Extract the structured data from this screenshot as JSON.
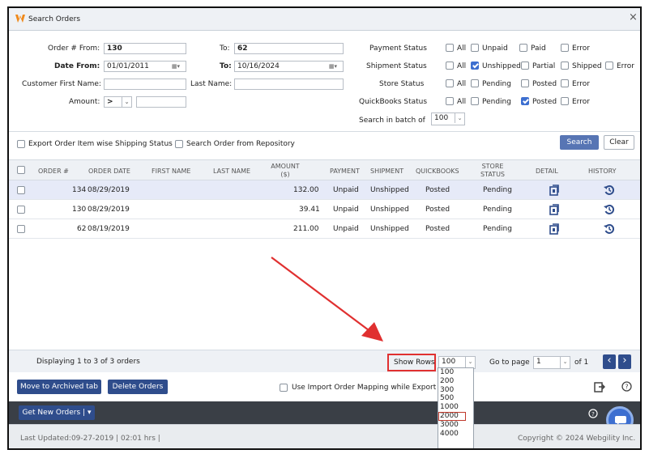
{
  "window": {
    "title": "Search Orders",
    "close": "×"
  },
  "filters": {
    "order_from_label": "Order # From:",
    "order_from": "130",
    "order_to_label": "To:",
    "order_to": "62",
    "date_from_label": "Date From:",
    "date_from": "01/01/2011",
    "date_to_label": "To:",
    "date_to": "10/16/2024",
    "first_name_label": "Customer First Name:",
    "first_name": "",
    "last_name_label": "Last Name:",
    "last_name": "",
    "amount_label": "Amount:",
    "amount_op": ">",
    "amount": "",
    "payment_label": "Payment Status",
    "shipment_label": "Shipment Status",
    "store_label": "Store  Status",
    "quickbooks_label": "QuickBooks Status",
    "batch_label": "Search in batch of",
    "batch": "100",
    "opt_all": "All",
    "opt_unpaid": "Unpaid",
    "opt_paid": "Paid",
    "opt_error": "Error",
    "opt_unshipped": "Unshipped",
    "opt_partial": "Partial",
    "opt_shipped": "Shipped",
    "opt_pending": "Pending",
    "opt_posted": "Posted"
  },
  "options": {
    "export_label": "Export Order Item wise Shipping Status",
    "repo_label": "Search Order from Repository",
    "search": "Search",
    "clear": "Clear"
  },
  "table": {
    "headers": {
      "order": "ORDER #",
      "date": "ORDER DATE",
      "first": "FIRST NAME",
      "last": "LAST NAME",
      "amount1": "AMOUNT",
      "amount2": "($)",
      "payment": "PAYMENT",
      "shipment": "SHIPMENT",
      "quickbooks": "QUICKBOOKS",
      "store1": "STORE",
      "store2": "STATUS",
      "detail": "DETAIL",
      "history": "HISTORY"
    },
    "rows": [
      {
        "order": "134",
        "date": "08/29/2019",
        "amount": "132.00",
        "payment": "Unpaid",
        "shipment": "Unshipped",
        "quickbooks": "Posted",
        "store": "Pending"
      },
      {
        "order": "130",
        "date": "08/29/2019",
        "amount": "39.41",
        "payment": "Unpaid",
        "shipment": "Unshipped",
        "quickbooks": "Posted",
        "store": "Pending"
      },
      {
        "order": "62",
        "date": "08/19/2019",
        "amount": "211.00",
        "payment": "Unpaid",
        "shipment": "Unshipped",
        "quickbooks": "Posted",
        "store": "Pending"
      }
    ]
  },
  "footer": {
    "displaying": "Displaying 1 to 3 of 3 orders",
    "show_rows": "Show Rows",
    "rows_value": "100",
    "goto_label": "Go to page",
    "page": "1",
    "of": "of 1",
    "rows_options": [
      "100",
      "200",
      "300",
      "500",
      "1000",
      "2000",
      "3000",
      "4000"
    ]
  },
  "actions": {
    "archive": "Move to Archived tab",
    "delete": "Delete Orders",
    "mapping": "Use Import Order Mapping while Export",
    "get_new": "Get New Orders |"
  },
  "status": {
    "updated": "Last Updated:09-27-2019 | 02:01 hrs |",
    "copyright": "Copyright © 2024 Webgility Inc."
  },
  "colors": {
    "accent": "#2f4d8c",
    "highlight": "#e03030",
    "checked": "#3d6fd0"
  }
}
